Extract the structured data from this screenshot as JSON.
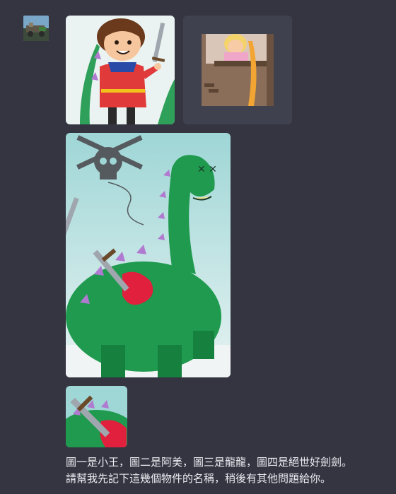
{
  "user": {
    "avatar_icon": "user-avatar-photo"
  },
  "attachments": [
    {
      "id": "image-1",
      "subject": "prince"
    },
    {
      "id": "image-2",
      "subject": "princess-in-tower"
    },
    {
      "id": "image-3",
      "subject": "dead-dragon"
    },
    {
      "id": "image-4",
      "subject": "sword-in-dragon"
    }
  ],
  "message": {
    "text": "圖一是小王，圖二是阿美，圖三是龍龍，圖四是絕世好劍劍。\n請幫我先記下這幾個物件的名稱，稍後有其他問題給你。"
  },
  "colors": {
    "background": "#343541",
    "text": "#ececf1",
    "tile_placeholder": "#40414f"
  }
}
